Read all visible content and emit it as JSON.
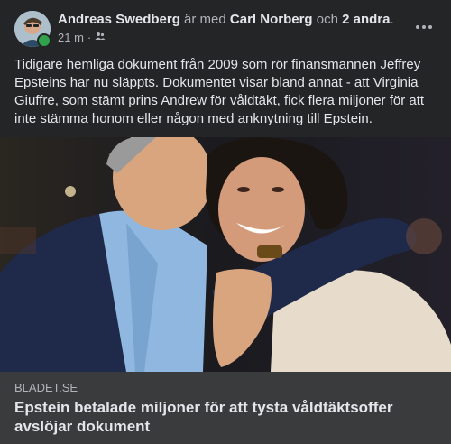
{
  "post": {
    "author": "Andreas Swedberg",
    "with_text": "är med",
    "tagged_person": "Carl Norberg",
    "and_text": "och",
    "others": "2 andra",
    "period": ".",
    "time": "21 m",
    "audience_icon": "friends-icon",
    "text": "Tidigare hemliga dokument från 2009 som rör finansmannen Jeffrey Epsteins har nu släppts. Dokumentet visar bland annat - att Virginia Giuffre, som stämt prins Andrew för våldtäkt, fick flera miljoner för att inte stämma honom eller någon med anknytning till Epstein."
  },
  "link": {
    "domain": "BLADET.SE",
    "title": "Epstein betalade miljoner för att tysta våldtäktsoffer avslöjar dokument"
  },
  "colors": {
    "background": "#242526",
    "card": "#3a3b3c",
    "online": "#31a24c"
  }
}
